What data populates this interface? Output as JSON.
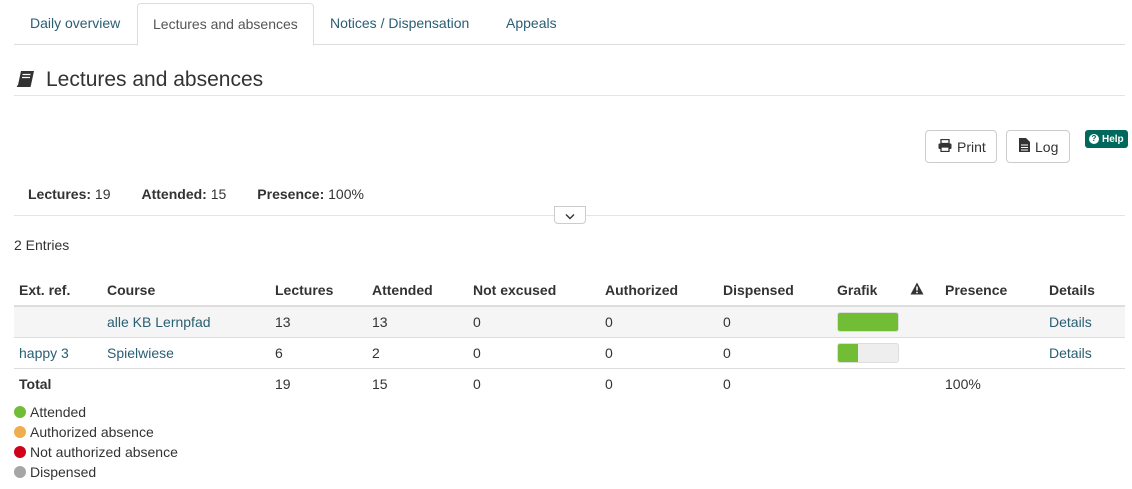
{
  "tabs": [
    {
      "label": "Daily overview",
      "active": false
    },
    {
      "label": "Lectures and absences",
      "active": true
    },
    {
      "label": "Notices / Dispensation",
      "active": false
    },
    {
      "label": "Appeals",
      "active": false
    }
  ],
  "page": {
    "title": "Lectures and absences",
    "icon": "book-icon"
  },
  "toolbar": {
    "print_label": "Print",
    "log_label": "Log",
    "help_label": "Help"
  },
  "summary": {
    "lectures_label": "Lectures:",
    "lectures_value": "19",
    "attended_label": "Attended:",
    "attended_value": "15",
    "presence_label": "Presence:",
    "presence_value": "100%"
  },
  "entries_text": "2 Entries",
  "table": {
    "headers": [
      "Ext. ref.",
      "Course",
      "Lectures",
      "Attended",
      "Not excused",
      "Authorized",
      "Dispensed",
      "Grafik",
      "warning-icon",
      "Presence",
      "Details"
    ],
    "rows": [
      {
        "ext_ref": "",
        "course": "alle KB Lernpfad",
        "lectures": "13",
        "attended": "13",
        "not_excused": "0",
        "authorized": "0",
        "dispensed": "0",
        "attended_fraction": 1.0,
        "presence": "",
        "details": "Details"
      },
      {
        "ext_ref": "happy 3",
        "course": "Spielwiese",
        "lectures": "6",
        "attended": "2",
        "not_excused": "0",
        "authorized": "0",
        "dispensed": "0",
        "attended_fraction": 0.33,
        "presence": "",
        "details": "Details"
      }
    ],
    "total": {
      "label": "Total",
      "lectures": "19",
      "attended": "15",
      "not_excused": "0",
      "authorized": "0",
      "dispensed": "0",
      "presence": "100%"
    }
  },
  "legend": [
    {
      "label": "Attended",
      "color": "#71bd35"
    },
    {
      "label": "Authorized absence",
      "color": "#f0ad4e"
    },
    {
      "label": "Not authorized absence",
      "color": "#d0021b"
    },
    {
      "label": "Dispensed",
      "color": "#a6a6a6"
    }
  ],
  "colors": {
    "accent": "#2a5e73",
    "help": "#00695c",
    "bar_attended": "#71bd35"
  }
}
